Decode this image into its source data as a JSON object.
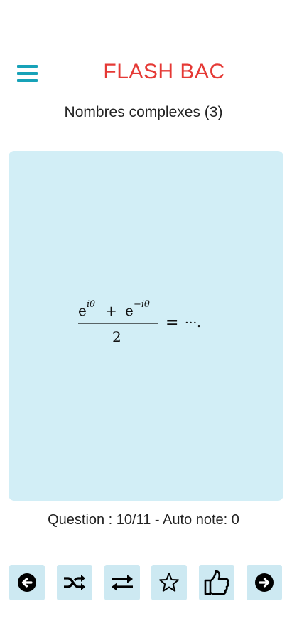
{
  "colors": {
    "accent": "#17a2b8",
    "title": "#e53935",
    "card_background": "#d2eef6",
    "button_background": "#cde9f2"
  },
  "header": {
    "menu_icon": "hamburger-menu-icon",
    "title": "FLASH BAC"
  },
  "deck": {
    "title": "Nombres complexes (3)"
  },
  "card": {
    "formula": {
      "numerator_first_base": "e",
      "numerator_first_exponent": "iθ",
      "operator": "+",
      "numerator_second_base": "e",
      "numerator_second_exponent": "−iθ",
      "denominator": "2",
      "equals": "=",
      "ellipsis": "···."
    }
  },
  "status": {
    "text": "Question : 10/11 - Auto note: 0"
  },
  "toolbar": {
    "buttons": [
      {
        "icon": "previous-arrow-icon"
      },
      {
        "icon": "shuffle-icon"
      },
      {
        "icon": "swap-arrows-icon"
      },
      {
        "icon": "star-outline-icon"
      },
      {
        "icon": "thumbs-up-icon"
      },
      {
        "icon": "next-arrow-icon"
      }
    ]
  }
}
